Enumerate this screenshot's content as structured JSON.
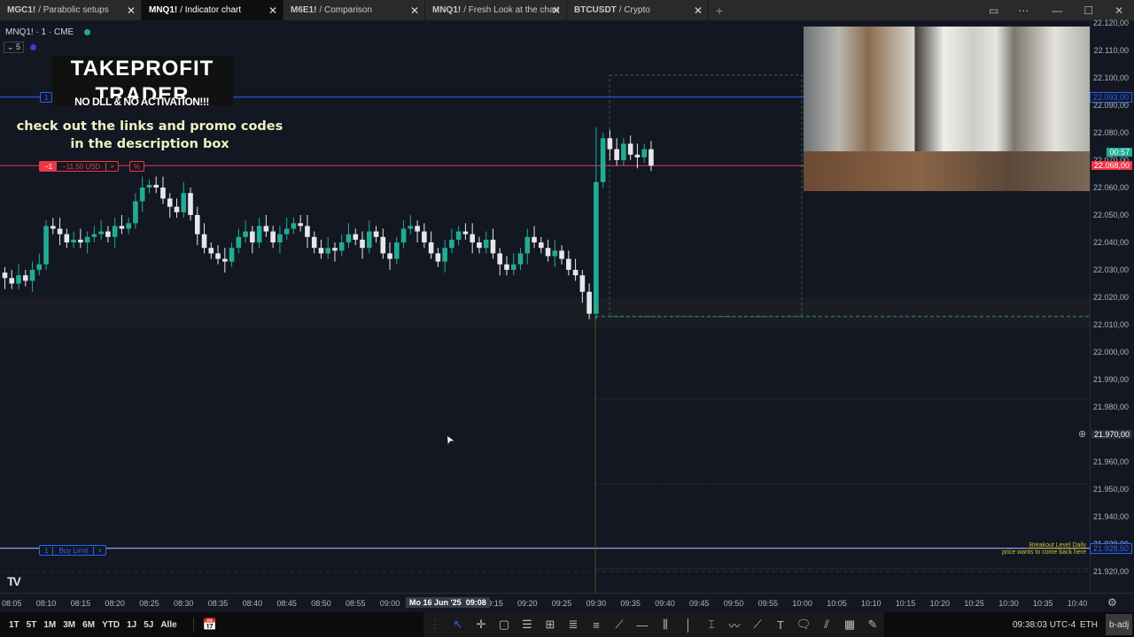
{
  "tabs": [
    {
      "symbol": "MGC1!",
      "name": "/ Parabolic setups",
      "active": false
    },
    {
      "symbol": "MNQ1!",
      "name": "/ Indicator chart",
      "active": true
    },
    {
      "symbol": "M6E1!",
      "name": "/ Comparison",
      "active": false
    },
    {
      "symbol": "MNQ1!",
      "name": "/ Fresh Look at the charts",
      "active": false
    },
    {
      "symbol": "BTCUSDT",
      "name": "/ Crypto",
      "active": false
    }
  ],
  "legend": {
    "symbol": "MNQ1! · 1 · CME",
    "indicator_count": "5"
  },
  "promo": {
    "brand": "TAKEPROFIT TRADER",
    "tagline": "NO DLL & NO ACTIVATION!!!",
    "line1": "check out the links and promo codes",
    "line2": "in the description box"
  },
  "orders": {
    "position_qty": "−1",
    "position_pnl": "−11,50 USD",
    "position_close": "×",
    "position_pct": "%",
    "tp_qty": "1",
    "buy_limit_qty": "1",
    "buy_limit_label": "Buy Limit",
    "buy_limit_close": "×"
  },
  "annotation": {
    "line1": "Breakout Level Daily",
    "line2": "price wants to come back here"
  },
  "price_labels": {
    "tp": "22.093,00",
    "countdown": "00:57",
    "last": "22.068,00",
    "crosshair": "21.970,00",
    "buy_limit": "21.928,50"
  },
  "time_axis": {
    "crosshair_date": "Mo 16 Jun '25",
    "crosshair_time": "09:08"
  },
  "range_buttons": [
    "1T",
    "5T",
    "1M",
    "3M",
    "6M",
    "YTD",
    "1J",
    "5J",
    "Alle"
  ],
  "status": {
    "clock": "09:38:03 UTC-4",
    "session": "ETH",
    "adj": "b-adj"
  },
  "colors": {
    "up": "#22ab94",
    "down": "#e6e7ea",
    "position": "#f23645",
    "order": "#2962ff"
  },
  "chart_data": {
    "type": "candlestick",
    "symbol": "MNQ1!",
    "interval": "1",
    "ylim": [
      21915,
      22122
    ],
    "y_ticks": [
      "22.120,00",
      "22.110,00",
      "22.100,00",
      "22.090,00",
      "22.080,00",
      "22.070,00",
      "22.060,00",
      "22.050,00",
      "22.040,00",
      "22.030,00",
      "22.020,00",
      "22.010,00",
      "22.000,00",
      "21.990,00",
      "21.980,00",
      "21.960,00",
      "21.950,00",
      "21.940,00",
      "21.930,00",
      "21.920,00"
    ],
    "y_tick_values": [
      22120,
      22110,
      22100,
      22090,
      22080,
      22070,
      22060,
      22050,
      22040,
      22030,
      22020,
      22010,
      22000,
      21990,
      21980,
      21960,
      21950,
      21940,
      21930,
      21920
    ],
    "x_ticks": [
      "08:05",
      "08:10",
      "08:15",
      "08:20",
      "08:25",
      "08:30",
      "08:35",
      "08:40",
      "08:45",
      "08:50",
      "08:55",
      "09:00",
      "09:15",
      "09:20",
      "09:25",
      "09:30",
      "09:35",
      "09:40",
      "09:45",
      "09:50",
      "09:55",
      "10:00",
      "10:05",
      "10:10",
      "10:15",
      "10:20",
      "10:25",
      "10:30",
      "10:35",
      "10:40"
    ],
    "x_tick_minutes": [
      485,
      490,
      495,
      500,
      505,
      510,
      515,
      520,
      525,
      530,
      535,
      540,
      555,
      560,
      565,
      570,
      575,
      580,
      585,
      590,
      595,
      600,
      605,
      610,
      615,
      620,
      625,
      630,
      635,
      640
    ],
    "start_minute": 484,
    "start_open": 22029,
    "closes": [
      22027,
      22025,
      22028,
      22026,
      22030,
      22032,
      22046,
      22045,
      22043,
      22040,
      22041,
      22040,
      22042,
      22043,
      22044,
      22042,
      22046,
      22045,
      22047,
      22055,
      22060,
      22061,
      22060,
      22056,
      22053,
      22051,
      22058,
      22050,
      22043,
      22038,
      22036,
      22034,
      22033,
      22038,
      22042,
      22044,
      22040,
      22046,
      22044,
      22040,
      22043,
      22045,
      22047,
      22046,
      22042,
      22038,
      22036,
      22038,
      22037,
      22040,
      22043,
      22041,
      22038,
      22044,
      22042,
      22036,
      22034,
      22040,
      22045,
      22046,
      22044,
      22040,
      22036,
      22033,
      22038,
      22041,
      22044,
      22043,
      22040,
      22038,
      22041,
      22036,
      22032,
      22030,
      22032,
      22036,
      22042,
      22040,
      22038,
      22035,
      22037,
      22034,
      22030,
      22028,
      22022,
      22014,
      22062,
      22078,
      22074,
      22070,
      22076,
      22072,
      22071,
      22074,
      22068
    ]
  }
}
